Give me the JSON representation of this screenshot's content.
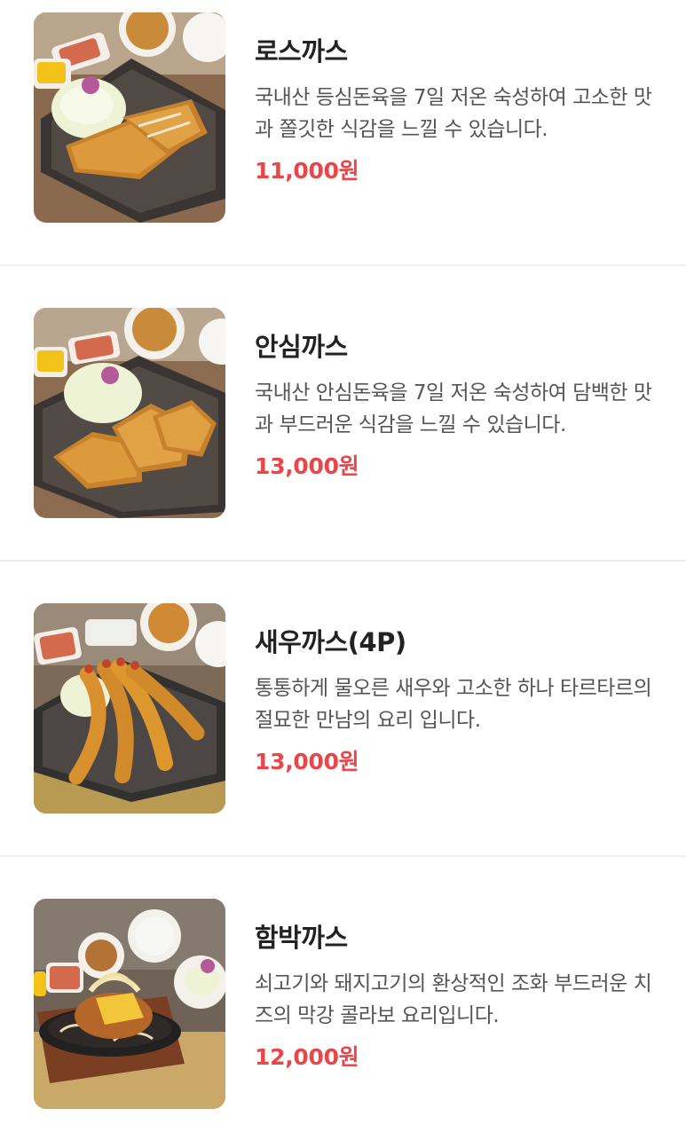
{
  "colors": {
    "price": "#e8474a",
    "name": "#222222",
    "description": "#555555",
    "divider": "#eeeeee"
  },
  "menu": {
    "items": [
      {
        "name": "로스까스",
        "description": "국내산 등심돈육을 7일 저온 숙성하여 고소한 맛과 쫄깃한 식감을 느낄 수 있습니다.",
        "price": "11,000원",
        "image_icon": "pork-loin-cutlet-photo"
      },
      {
        "name": "안심까스",
        "description": "국내산 안심돈육을 7일 저온 숙성하여 담백한 맛과 부드러운 식감을 느낄 수 있습니다.",
        "price": "13,000원",
        "image_icon": "tenderloin-cutlet-photo"
      },
      {
        "name": "새우까스(4P)",
        "description": "통통하게 물오른 새우와 고소한 하나 타르타르의 절묘한 만남의 요리 입니다.",
        "price": "13,000원",
        "image_icon": "fried-shrimp-photo"
      },
      {
        "name": "함박까스",
        "description": "쇠고기와 돼지고기의 환상적인 조화 부드러운 치즈의 막강 콜라보 요리입니다.",
        "price": "12,000원",
        "image_icon": "hamburg-cutlet-photo"
      }
    ]
  }
}
